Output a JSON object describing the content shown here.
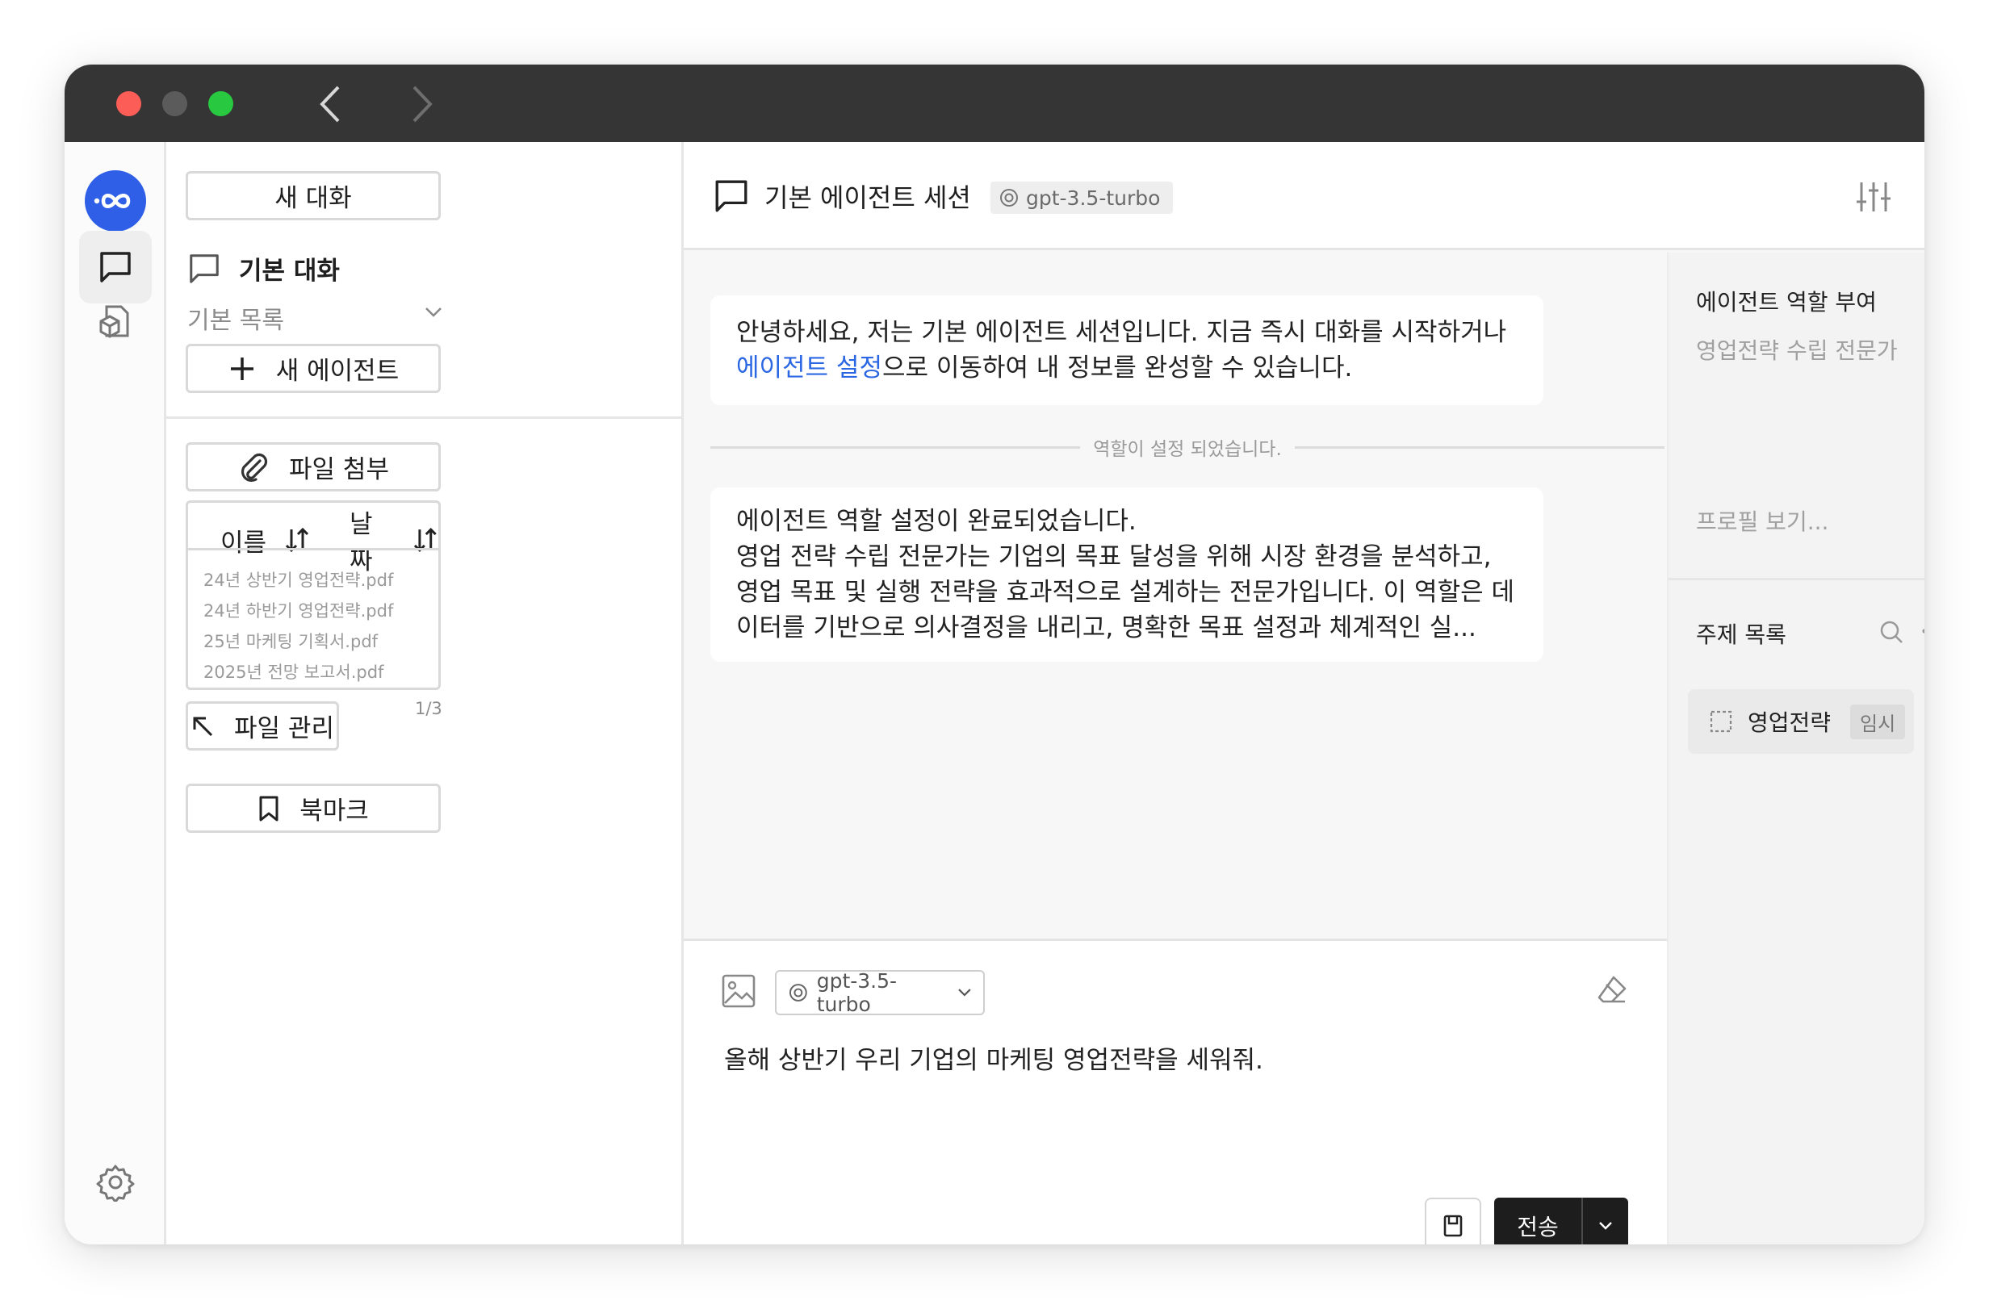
{
  "colors": {
    "accent": "#2f5fe6",
    "link": "#2b66e3",
    "send_bg": "#1d1d1d",
    "titlebar": "#353535"
  },
  "sidebar": {
    "new_chat_label": "새 대화",
    "default_chat_label": "기본 대화",
    "default_list_label": "기본 목록",
    "new_agent_label": "새 에이전트",
    "attach_label": "파일 첨부",
    "sort_name_label": "이름",
    "sort_date_label": "날짜",
    "files": [
      "24년 상반기 영업전략.pdf",
      "24년 하반기 영업전략.pdf",
      "25년 마케팅 기획서.pdf",
      "2025년 전망 보고서.pdf"
    ],
    "pager": "1/3",
    "file_manage_label": "파일 관리",
    "bookmark_label": "북마크"
  },
  "header": {
    "session_title": "기본 에이전트 세션",
    "model_badge": "gpt-3.5-turbo"
  },
  "chat": {
    "welcome_line1": "안녕하세요, 저는 기본 에이전트 세션입니다. 지금 즉시 대화를 시작하거나",
    "welcome_link": "에이전트 설정",
    "welcome_line2_rest": "으로 이동하여 내 정보를 완성할 수 있습니다.",
    "system_notice": "역할이 설정 되었습니다.",
    "role_msg_lines": [
      "에이전트 역할 설정이 완료되었습니다.",
      "영업 전략 수립 전문가는 기업의 목표 달성을 위해 시장 환경을 분석하고,",
      "영업 목표 및 실행 전략을 효과적으로 설계하는 전문가입니다. 이 역할은 데",
      "이터를 기반으로 의사결정을 내리고, 명확한 목표 설정과 체계적인 실..."
    ]
  },
  "right_panel": {
    "role_title": "에이전트 역할 부여",
    "role_value": "영업전략 수립 전문가",
    "profile_link": "프로필 보기...",
    "topics_title": "주제 목록",
    "topic_item": "영업전략",
    "topic_badge": "임시"
  },
  "composer": {
    "model": "gpt-3.5-turbo",
    "input_value": "올해  상반기 우리 기업의 마케팅 영업전략을 세워줘.",
    "send_label": "전송"
  }
}
